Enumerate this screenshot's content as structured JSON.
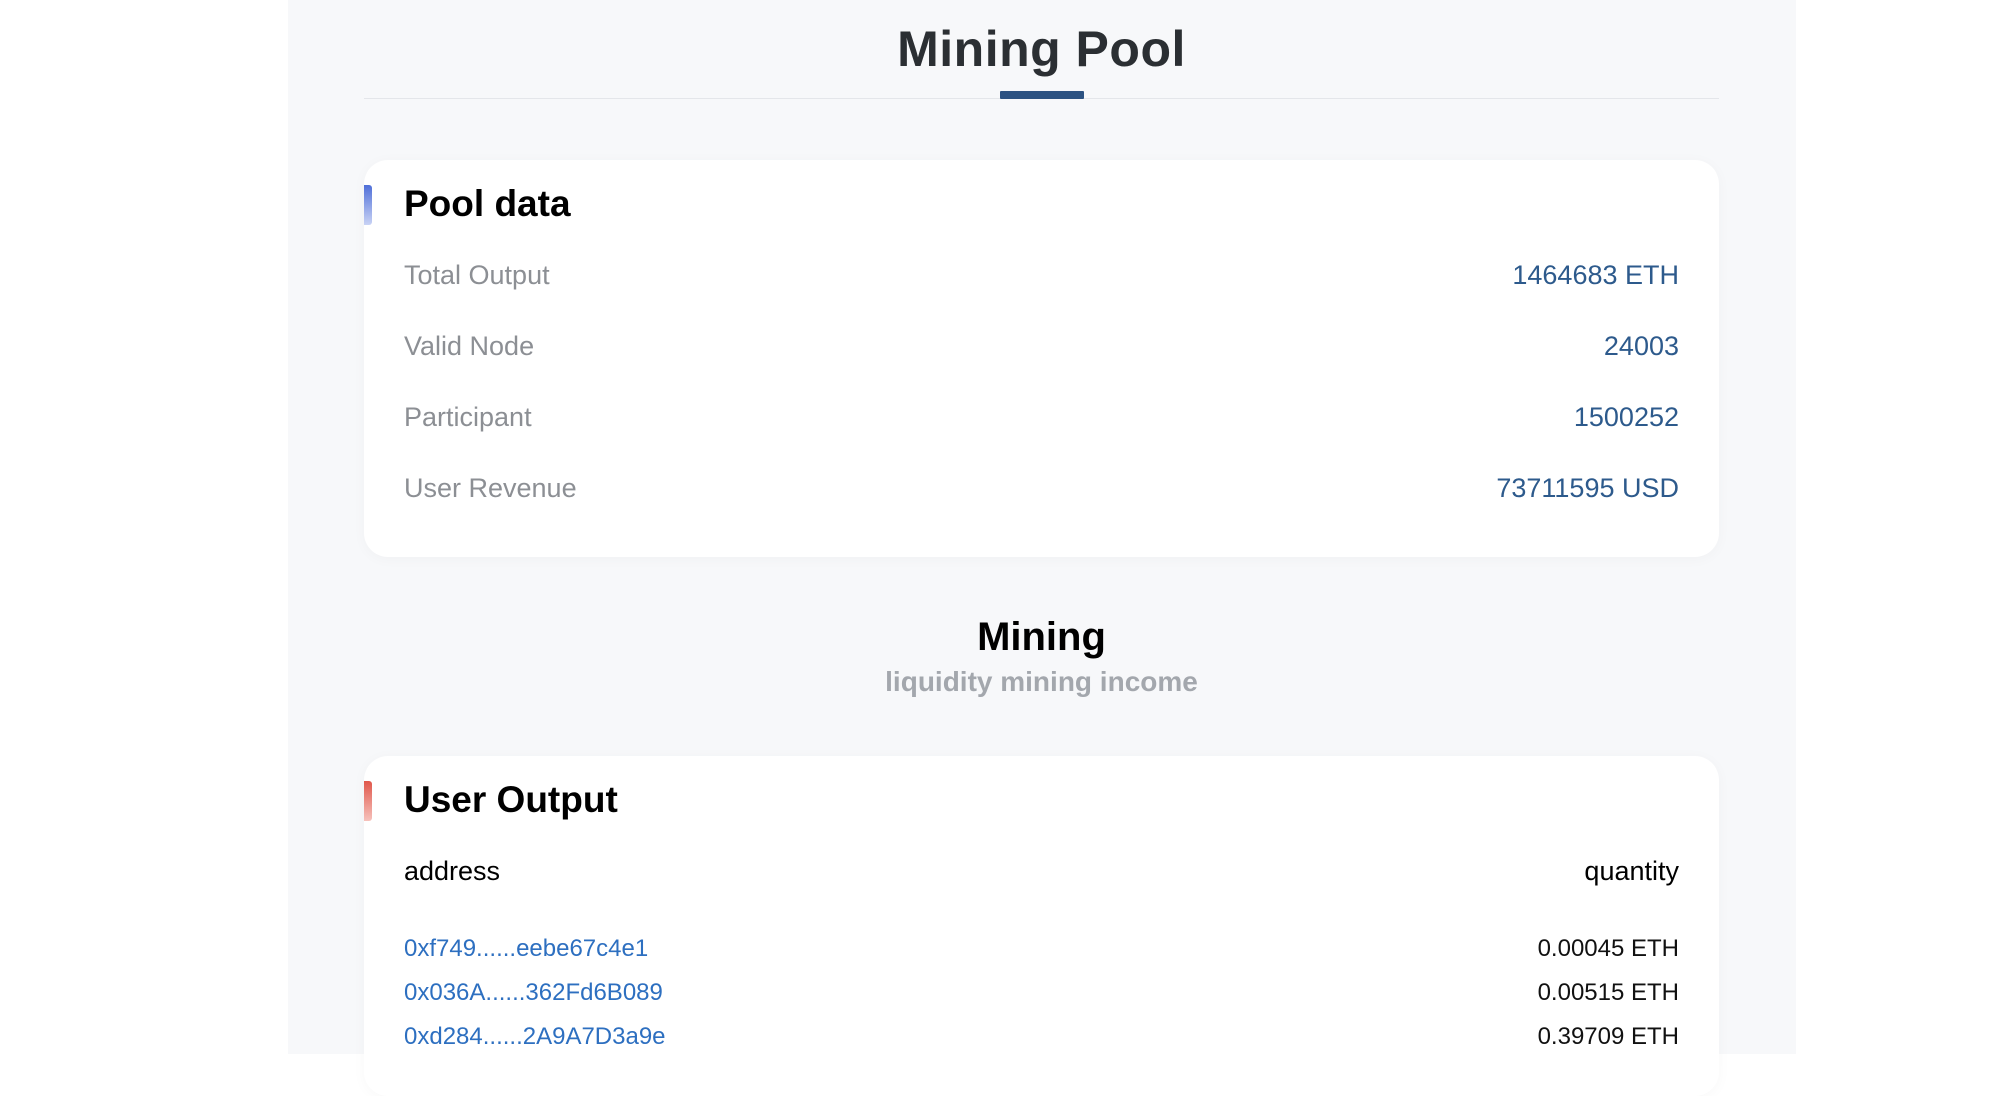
{
  "header": {
    "title": "Mining Pool"
  },
  "pool_data": {
    "title": "Pool data",
    "rows": [
      {
        "label": "Total Output",
        "value": "1464683 ETH"
      },
      {
        "label": "Valid Node",
        "value": "24003"
      },
      {
        "label": "Participant",
        "value": "1500252"
      },
      {
        "label": "User Revenue",
        "value": "73711595 USD"
      }
    ]
  },
  "mining": {
    "title": "Mining",
    "subtitle": "liquidity mining income"
  },
  "user_output": {
    "title": "User Output",
    "columns": {
      "address": "address",
      "quantity": "quantity"
    },
    "rows": [
      {
        "address": "0xf749......eebe67c4e1",
        "quantity": "0.00045 ETH"
      },
      {
        "address": "0x036A......362Fd6B089",
        "quantity": "0.00515 ETH"
      },
      {
        "address": "0xd284......2A9A7D3a9e",
        "quantity": "0.39709 ETH"
      }
    ]
  },
  "colors": {
    "accent": "#2c5282",
    "value_blue": "#2d5a8c",
    "link_blue": "#2d6fc0",
    "pool_accent": "#4f6fd8",
    "user_accent": "#e0574b"
  }
}
